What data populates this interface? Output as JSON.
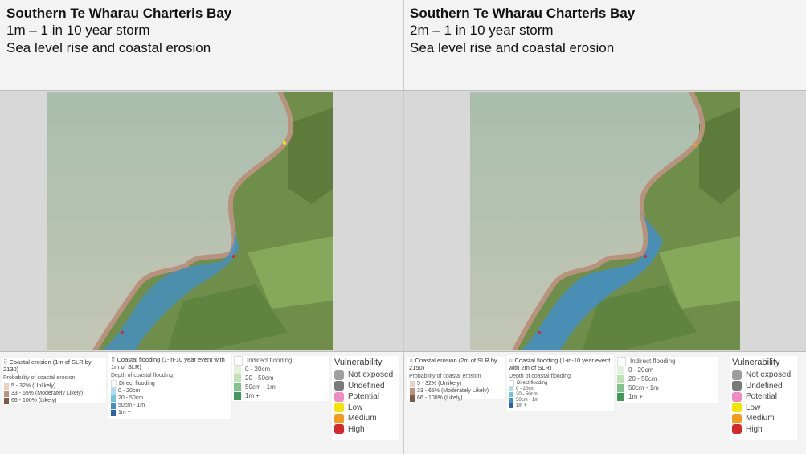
{
  "panels": [
    {
      "title": "Southern Te Wharau Charteris Bay",
      "scenario": "1m – 1 in 10 year storm",
      "subtitle": "Sea level rise and coastal erosion",
      "erosion_legend": {
        "title": "Coastal erosion (1m of SLR by 2130)",
        "subtitle": "Probability of coastal erosion",
        "items": [
          "5 - 32% (Unlikely)",
          "33 - 65% (Moderately Likely)",
          "66 - 100% (Likely)"
        ]
      },
      "flood_legend": {
        "title": "Coastal flooding (1-in-10 year event with 1m of SLR)",
        "subtitle": "Depth of coastal flooding",
        "direct_label": "Direct flooding",
        "items": [
          "0 - 20cm",
          "20 - 50cm",
          "50cm - 1m",
          "1m +"
        ]
      },
      "indirect_legend": {
        "title": "Indirect flooding",
        "items": [
          "0 - 20cm",
          "20 - 50cm",
          "50cm - 1m",
          "1m +"
        ]
      }
    },
    {
      "title": "Southern Te Wharau Charteris Bay",
      "scenario": "2m – 1 in 10 year storm",
      "subtitle": "Sea level rise and coastal erosion",
      "erosion_legend": {
        "title": "Coastal erosion (2m of SLR by 2150)",
        "subtitle": "Probability of coastal erosion",
        "items": [
          "5 - 32% (Unlikely)",
          "33 - 65% (Moderately Likely)",
          "66 - 100% (Likely)"
        ]
      },
      "flood_legend": {
        "title": "Coastal flooding (1-in-10 year event with 2m of SLR)",
        "subtitle": "Depth of coastal flooding",
        "direct_label": "Direct flooding",
        "items": [
          "0 - 20cm",
          "20 - 50cm",
          "50cm - 1m",
          "1m +"
        ]
      },
      "indirect_legend": {
        "title": "Indirect flooding",
        "items": [
          "0 - 20cm",
          "20 - 50cm",
          "50cm - 1m",
          "1m +"
        ]
      }
    }
  ],
  "vulnerability": {
    "title": "Vulnerability",
    "items": [
      "Not exposed",
      "Undefined",
      "Potential",
      "Low",
      "Medium",
      "High"
    ]
  },
  "colors": {
    "erosion": [
      "#e8d2c2",
      "#b8927d",
      "#7e5a48"
    ],
    "flood": [
      "#a9dff0",
      "#73c3e2",
      "#3f8fcf",
      "#2c5fae"
    ],
    "indirect": [
      "#e2f2dc",
      "#bfe3b3",
      "#7fc48a",
      "#3e9a5b"
    ],
    "vulnerability": [
      "#9e9e9e",
      "#7a7a7a",
      "#f08ac4",
      "#f5e400",
      "#f59a1d",
      "#d7282a"
    ],
    "sea": "#b9c7b4",
    "land": "#6f8e4a"
  }
}
